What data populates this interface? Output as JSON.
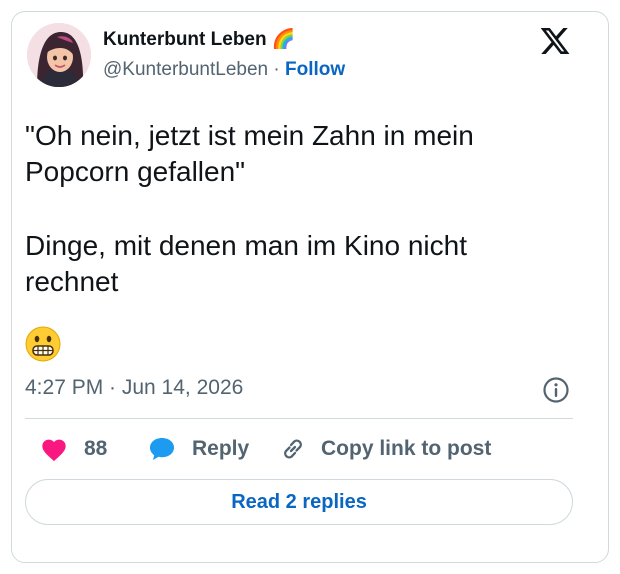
{
  "author": {
    "name": "Kunterbunt Leben 🌈",
    "handle": "@KunterbuntLeben",
    "separator": "·",
    "follow_label": "Follow"
  },
  "tweet": {
    "line1": "\"Oh nein, jetzt ist mein Zahn in mein",
    "line2": "Popcorn gefallen\"",
    "line3": "Dinge, mit denen man im Kino nicht",
    "line4": "rechnet",
    "emoji": "grimacing-face"
  },
  "meta": {
    "timestamp": "4:27 PM · Jun 14, 2026"
  },
  "actions": {
    "like_count": "88",
    "reply_label": "Reply",
    "copy_label": "Copy link to post"
  },
  "read_replies_label": "Read 2 replies",
  "colors": {
    "heart": "#f91880",
    "reply_bubble": "#1d9bf0",
    "link_blue": "#0a66c2",
    "muted": "#536471",
    "border": "#cfd9de"
  },
  "icons": [
    "x-logo-icon",
    "info-icon",
    "heart-icon",
    "reply-bubble-icon",
    "link-icon",
    "grimacing-face-emoji"
  ]
}
